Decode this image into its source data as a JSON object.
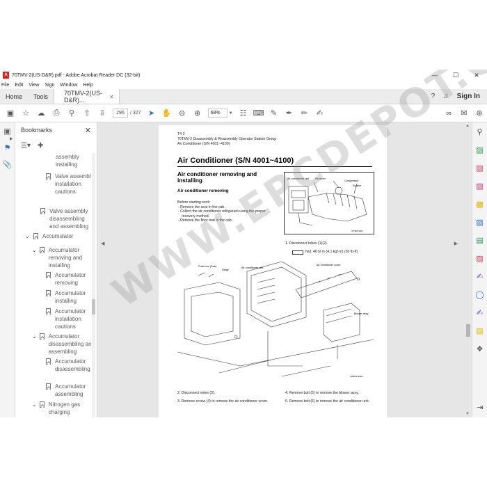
{
  "window": {
    "title": "70TMV-2(US-D&R).pdf - Adobe Acrobat Reader DC (32-bit)",
    "app_icon_letter": "A",
    "minimize": "—",
    "maximize": "☐",
    "close": "✕"
  },
  "menu": [
    "File",
    "Edit",
    "View",
    "Sign",
    "Window",
    "Help"
  ],
  "tabs": {
    "home": "Home",
    "tools": "Tools",
    "document": "70TMV-2(US-D&R)...",
    "document_close": "×",
    "sign_in": "Sign In"
  },
  "toolbar": {
    "current_page": "296",
    "page_total": "/ 327",
    "zoom": "68%"
  },
  "bookmarks": {
    "title": "Bookmarks",
    "close": "✕",
    "items": [
      {
        "label": "assembly installing",
        "kind": "leaf-partial"
      },
      {
        "label": "Valve assembly installation cautions",
        "kind": "leaf"
      },
      {
        "label": "Valve assembly disassembling and assembling",
        "kind": "leaf"
      },
      {
        "label": "Accumulator",
        "kind": "group"
      },
      {
        "label": "Accumulator removing and installing",
        "kind": "group"
      },
      {
        "label": "Accumulator removing",
        "kind": "leaf"
      },
      {
        "label": "Accumulator installing",
        "kind": "leaf"
      },
      {
        "label": "Accumulator installation cautions",
        "kind": "leaf"
      },
      {
        "label": "Accumulator disassembling and assembling",
        "kind": "group"
      },
      {
        "label": "Accumulator disassembling",
        "kind": "leaf"
      },
      {
        "label": "Accumulator assembling",
        "kind": "leaf"
      },
      {
        "label": "Nitrogen gas charging",
        "kind": "group"
      }
    ]
  },
  "pdf_page": {
    "header_code": "T4-2",
    "header_line1": "70TMV-2 Disassembly & Reassembly Operator Station Group",
    "header_line2": "Air Conditioner (S/N 4001~4100)",
    "title": "Air Conditioner (S/N 4001~4100)",
    "section": "Air conditioner removing and installing",
    "subsection": "Air conditioner removing",
    "before_start": "Before starting work:",
    "bullets": [
      "- Remove the seat in the cab.",
      "- Collect the air conditioner refrigerant using the proper recovery method.",
      "- Remove the floor mat in the cab."
    ],
    "fig1_labels": {
      "air_conditioner_unit": "Air conditioner unit",
      "receiver": "Receiver",
      "compressor": "Compressor",
      "engine": "Engine",
      "code": "70TM2T4002"
    },
    "step1": "1.   Disconnect tubes (1)(2).",
    "torque": "Nut: 40 N·m (4.1 kgf·m) (30 lb-ft)",
    "fig2_labels": {
      "fuse_box": "Fuse box (Cab)",
      "relay": "Relay",
      "air_conditioner_unit": "Air conditioner unit",
      "air_conditioner_cover": "Air conditioner cover",
      "blower_assy": "Blower assy",
      "code": "N3B0S27H000"
    },
    "step2": "2.   Disconnect wires (3).",
    "step3": "3.   Remove screw (4) to remove the air conditioner cover.",
    "step4": "4.   Remove bolt (5) to remove the blower assy.",
    "step5": "5.   Remove bolt (6) to remove the air conditioner unit."
  },
  "watermark": "WWW.EPCDEPOT.COM",
  "colors": {
    "acrobat_red": "#d4241c",
    "accent_blue": "#2b6fd6"
  }
}
